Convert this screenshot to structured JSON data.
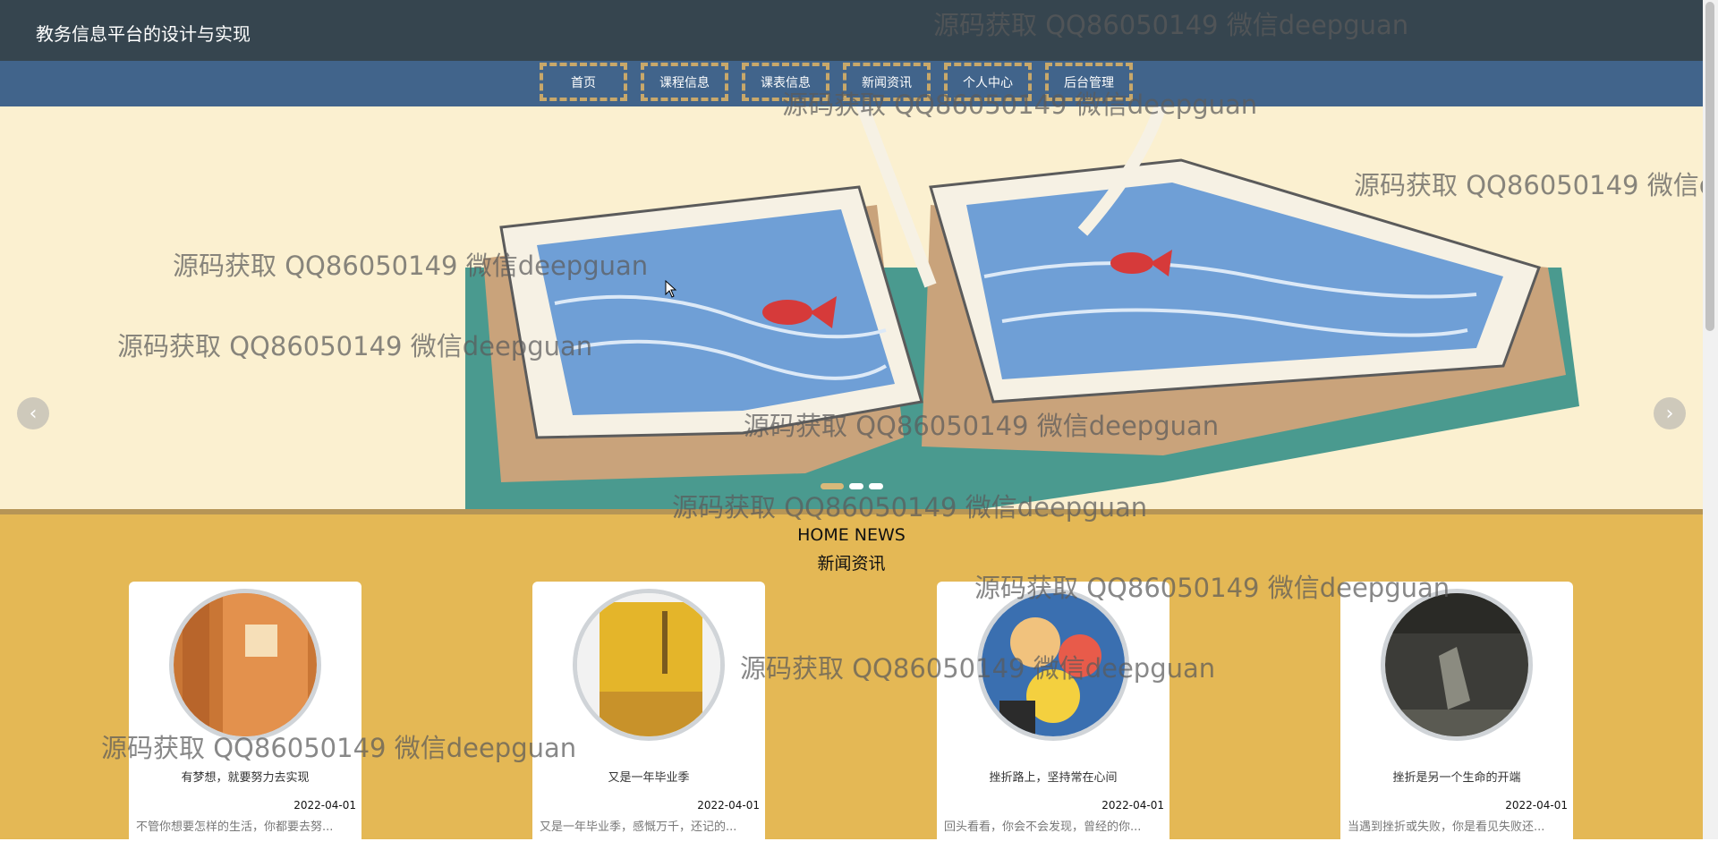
{
  "header": {
    "title": "教务信息平台的设计与实现"
  },
  "nav": {
    "items": [
      {
        "label": "首页"
      },
      {
        "label": "课程信息"
      },
      {
        "label": "课表信息"
      },
      {
        "label": "新闻资讯"
      },
      {
        "label": "个人中心"
      },
      {
        "label": "后台管理"
      }
    ]
  },
  "carousel": {
    "prev_icon": "chevron-left-icon",
    "next_icon": "chevron-right-icon",
    "prev_symbol": "‹",
    "next_symbol": "›",
    "active_slide": 1,
    "slide_count": 3
  },
  "news": {
    "heading_en": "HOME NEWS",
    "heading_cn": "新闻资讯",
    "items": [
      {
        "title": "有梦想，就要努力去实现",
        "date": "2022-04-01",
        "summary": "不管你想要怎样的生活，你都要去努..."
      },
      {
        "title": "又是一年毕业季",
        "date": "2022-04-01",
        "summary": "又是一年毕业季，感慨万千，还记的..."
      },
      {
        "title": "挫折路上，坚持常在心间",
        "date": "2022-04-01",
        "summary": "回头看看，你会不会发现，曾经的你..."
      },
      {
        "title": "挫折是另一个生命的开端",
        "date": "2022-04-01",
        "summary": "当遇到挫折或失败，你是看见失败还..."
      }
    ]
  },
  "watermark_text": "源码获取 QQ86050149 微信deepguan",
  "watermark_text_partial": "源码获取 QQ86050149 微信d",
  "colors": {
    "topbar": "#36454f",
    "navbar": "#41648b",
    "nav_border": "#c8a86a",
    "banner_bg": "#fbf0d0",
    "news_bg": "#e4b855"
  }
}
